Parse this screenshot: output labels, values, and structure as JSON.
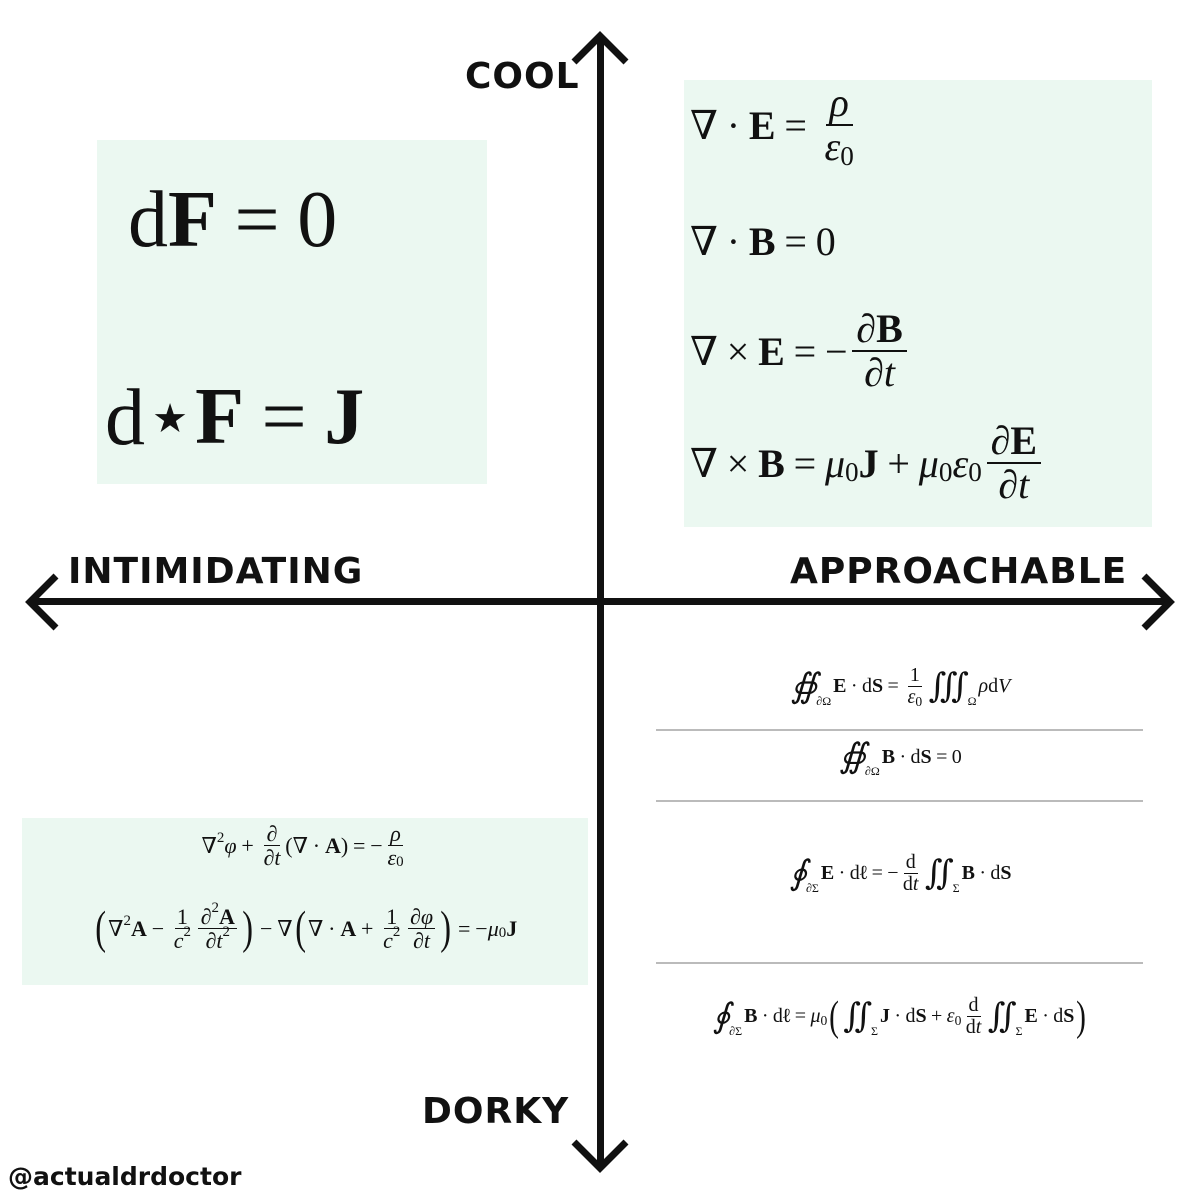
{
  "axes": {
    "top": "COOL",
    "bottom": "DORKY",
    "left": "INTIMIDATING",
    "right": "APPROACHABLE"
  },
  "watermark": "@actualdrdoctor",
  "colors": {
    "box": "#ebf8f1",
    "axis": "#111111",
    "rule": "#bbbbbb"
  },
  "quadrants": {
    "cool_intimidating": [
      [
        "d",
        {
          "b": "F"
        },
        {
          "op": "="
        },
        "0"
      ],
      [
        "d⋆",
        {
          "b": "F"
        },
        {
          "op": "="
        },
        {
          "b": "J"
        }
      ]
    ],
    "cool_approachable": [
      [
        "∇",
        {
          "op": "·"
        },
        {
          "b": "E"
        },
        {
          "op": "="
        },
        {
          "f": [
            [
              {
                "i": "ρ"
              }
            ],
            [
              {
                "i": "ε"
              },
              {
                "sub": "0"
              }
            ]
          ]
        }
      ],
      [
        "∇",
        {
          "op": "·"
        },
        {
          "b": "B"
        },
        {
          "op": "="
        },
        "0"
      ],
      [
        "∇",
        {
          "op": "×"
        },
        {
          "b": "E"
        },
        {
          "op": "="
        },
        "−",
        {
          "f": [
            [
              "∂",
              {
                "b": "B"
              }
            ],
            [
              "∂",
              {
                "i": "t"
              }
            ]
          ]
        }
      ],
      [
        "∇",
        {
          "op": "×"
        },
        {
          "b": "B"
        },
        {
          "op": "="
        },
        {
          "i": "μ"
        },
        {
          "sub": "0"
        },
        {
          "b": "J"
        },
        {
          "op": "+"
        },
        {
          "i": "μ"
        },
        {
          "sub": "0"
        },
        {
          "i": "ε"
        },
        {
          "sub": "0"
        },
        {
          "f": [
            [
              "∂",
              {
                "b": "E"
              }
            ],
            [
              "∂",
              {
                "i": "t"
              }
            ]
          ]
        }
      ]
    ],
    "dorky_intimidating": [
      [
        "∇",
        {
          "sup": "2"
        },
        {
          "i": "φ"
        },
        {
          "op": "+"
        },
        {
          "f": [
            [
              "∂"
            ],
            [
              "∂",
              {
                "i": "t"
              }
            ]
          ]
        },
        "(∇",
        {
          "op": "·"
        },
        {
          "b": "A"
        },
        ")",
        {
          "op": "="
        },
        "−",
        {
          "f": [
            [
              {
                "i": "ρ"
              }
            ],
            [
              {
                "i": "ε"
              },
              {
                "sub": "0"
              }
            ]
          ]
        }
      ],
      [
        {
          "big": "("
        },
        "∇",
        {
          "sup": "2"
        },
        {
          "b": "A"
        },
        {
          "op": "−"
        },
        {
          "f": [
            [
              "1"
            ],
            [
              {
                "i": "c"
              },
              {
                "sup": "2"
              }
            ]
          ]
        },
        {
          "f": [
            [
              "∂",
              {
                "sup": "2"
              },
              {
                "b": "A"
              }
            ],
            [
              "∂",
              {
                "i": "t"
              },
              {
                "sup": "2"
              }
            ]
          ]
        },
        {
          "big": ")"
        },
        {
          "op": "−"
        },
        "∇",
        {
          "big": "("
        },
        "∇",
        {
          "op": "·"
        },
        {
          "b": "A"
        },
        {
          "op": "+"
        },
        {
          "f": [
            [
              "1"
            ],
            [
              {
                "i": "c"
              },
              {
                "sup": "2"
              }
            ]
          ]
        },
        {
          "f": [
            [
              "∂",
              {
                "i": "φ"
              }
            ],
            [
              "∂",
              {
                "i": "t"
              }
            ]
          ]
        },
        {
          "big": ")"
        },
        {
          "op": "="
        },
        "−",
        {
          "i": "μ"
        },
        {
          "sub": "0"
        },
        {
          "b": "J"
        }
      ]
    ],
    "dorky_approachable": [
      [
        {
          "int": "∯",
          "lim": "∂Ω"
        },
        {
          "b": "E"
        },
        {
          "op": "·"
        },
        "d",
        {
          "b": "S"
        },
        {
          "op": "="
        },
        {
          "f": [
            [
              "1"
            ],
            [
              {
                "i": "ε"
              },
              {
                "sub": "0"
              }
            ]
          ]
        },
        {
          "int": "∭",
          "lim": "Ω"
        },
        {
          "i": "ρ"
        },
        " d",
        {
          "i": "V"
        }
      ],
      [
        {
          "int": "∯",
          "lim": "∂Ω"
        },
        {
          "b": "B"
        },
        {
          "op": "·"
        },
        "d",
        {
          "b": "S"
        },
        {
          "op": "="
        },
        "0"
      ],
      [
        {
          "int": "∮",
          "lim": "∂Σ"
        },
        {
          "b": "E"
        },
        {
          "op": "·"
        },
        "d",
        {
          "b": "ℓ"
        },
        {
          "op": "="
        },
        "−",
        {
          "f": [
            [
              "d"
            ],
            [
              "d",
              {
                "i": "t"
              }
            ]
          ]
        },
        {
          "int": "∬",
          "lim": "Σ"
        },
        {
          "b": "B"
        },
        {
          "op": "·"
        },
        "d",
        {
          "b": "S"
        }
      ],
      [
        {
          "int": "∮",
          "lim": "∂Σ"
        },
        {
          "b": "B"
        },
        {
          "op": "·"
        },
        "d",
        {
          "b": "ℓ"
        },
        {
          "op": "="
        },
        {
          "i": "μ"
        },
        {
          "sub": "0"
        },
        {
          "big": "("
        },
        {
          "int": "∬",
          "lim": "Σ"
        },
        {
          "b": "J"
        },
        {
          "op": "·"
        },
        "d",
        {
          "b": "S"
        },
        {
          "op": "+"
        },
        {
          "i": "ε"
        },
        {
          "sub": "0"
        },
        {
          "f": [
            [
              "d"
            ],
            [
              "d",
              {
                "i": "t"
              }
            ]
          ]
        },
        {
          "int": "∬",
          "lim": "Σ"
        },
        {
          "b": "E"
        },
        {
          "op": "·"
        },
        "d",
        {
          "b": "S"
        },
        {
          "big": ")"
        }
      ]
    ]
  }
}
